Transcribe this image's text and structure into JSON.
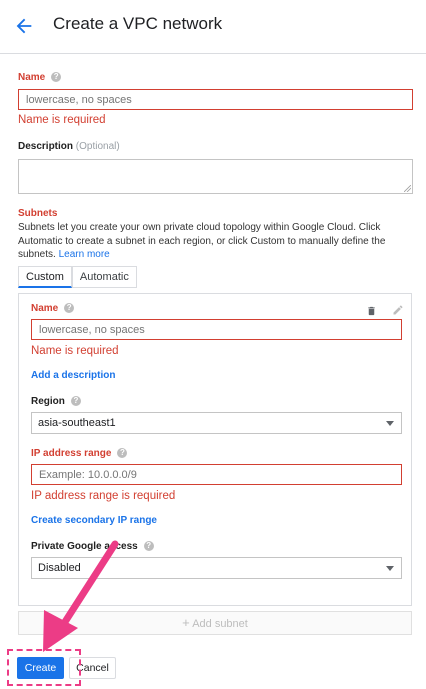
{
  "header": {
    "title": "Create a VPC network",
    "back_icon": "arrow-left-icon"
  },
  "name_field": {
    "label": "Name",
    "placeholder": "lowercase, no spaces",
    "error": "Name is required"
  },
  "description_field": {
    "label": "Description",
    "optional": "(Optional)"
  },
  "subnets": {
    "label": "Subnets",
    "description": "Subnets let you create your own private cloud topology within Google Cloud. Click Automatic to create a subnet in each region, or click Custom to manually define the subnets.",
    "learn_more": "Learn more",
    "tabs": [
      {
        "label": "Custom",
        "active": true
      },
      {
        "label": "Automatic",
        "active": false
      }
    ],
    "add_subnet": "Add subnet"
  },
  "subnet_panel": {
    "name_label": "Name",
    "name_placeholder": "lowercase, no spaces",
    "name_error": "Name is required",
    "add_description": "Add a description",
    "region_label": "Region",
    "region_value": "asia-southeast1",
    "ip_label": "IP address range",
    "ip_placeholder": "Example: 10.0.0.0/9",
    "ip_error": "IP address range is required",
    "secondary_ip": "Create secondary IP range",
    "pga_label": "Private Google access",
    "pga_value": "Disabled"
  },
  "buttons": {
    "create": "Create",
    "cancel": "Cancel"
  },
  "colors": {
    "primary": "#1a73e8",
    "error": "#d23f31",
    "annotation": "#ec3c86"
  }
}
